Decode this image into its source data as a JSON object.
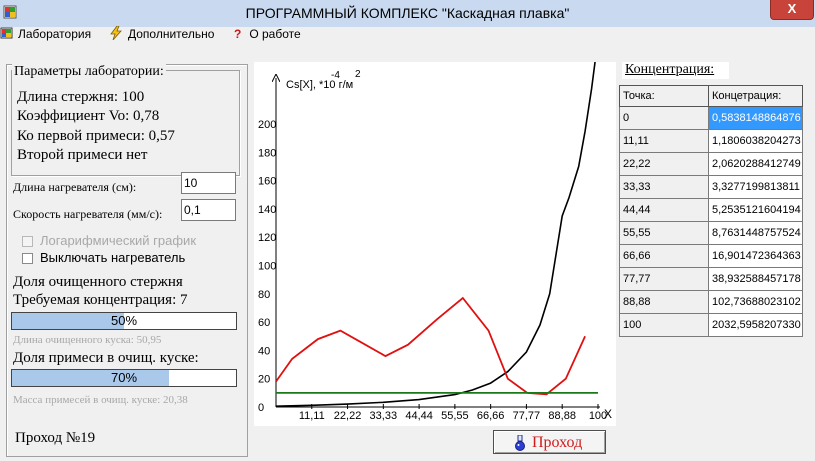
{
  "window": {
    "title": "ПРОГРАММНЫЙ КОМПЛЕКС \"Каскадная плавка\"",
    "close_label": "X"
  },
  "menu": [
    {
      "label": "Лаборатория",
      "icon": "lab-icon"
    },
    {
      "label": "Дополнительно",
      "icon": "lightning-icon"
    },
    {
      "label": "О работе",
      "icon": "question-icon"
    }
  ],
  "params": {
    "caption": "Параметры лаборатории:",
    "rod_length": "Длина стержня: 100",
    "coef": "Коэффициент Vo: 0,78",
    "first_impurity": "Ко первой примеси: 0,57",
    "second_impurity": "Второй примеси нет"
  },
  "heater_length": {
    "label": "Длина нагревателя (см):",
    "value": "10"
  },
  "heater_speed": {
    "label": "Скорость нагревателя (мм/с):",
    "value": "0,1"
  },
  "options": {
    "log_graph": {
      "label": "Логарифмический график",
      "checked": false,
      "disabled": true
    },
    "heater_off": {
      "label": "Выключать нагреватель",
      "checked": false,
      "disabled": false
    }
  },
  "purified": {
    "title": "Доля очищенного стержня",
    "required": "Требуемая концентрация: 7",
    "percent": 50,
    "percent_label": "50%",
    "length_note": "Длина очищенного куска: 50,95"
  },
  "impurity": {
    "title": "Доля примеси в очищ. куске:",
    "percent": 70,
    "percent_label": "70%",
    "mass_note": "Масса примесей в очищ. куске: 20,38"
  },
  "pass_label": "Проход №19",
  "go_button": "Проход",
  "table": {
    "caption": "Концентрация:",
    "headers": [
      "Точка:",
      "Концетрация:"
    ],
    "rows": [
      [
        "0",
        "0,5838148864876"
      ],
      [
        "11,11",
        "1,1806038204273"
      ],
      [
        "22,22",
        "2,0620288412749"
      ],
      [
        "33,33",
        "3,3277199813811"
      ],
      [
        "44,44",
        "5,2535121604194"
      ],
      [
        "55,55",
        "8,7631448757524"
      ],
      [
        "66,66",
        "16,901472364363"
      ],
      [
        "77,77",
        "38,932588457178"
      ],
      [
        "88,88",
        "102,73688023102"
      ],
      [
        "100",
        "2032,5958207330"
      ]
    ]
  },
  "chart_data": {
    "type": "line",
    "ylabel": "Cs[X], *10 г/м",
    "ylabel_exp1": "-4",
    "ylabel_exp2": "2",
    "xlabel": "X",
    "xlim": [
      0,
      100
    ],
    "ylim": [
      0,
      210
    ],
    "xticks": [
      "11,11",
      "22,22",
      "33,33",
      "44,44",
      "55,55",
      "66,66",
      "77,77",
      "88,88",
      "100"
    ],
    "xtick_values": [
      11.11,
      22.22,
      33.33,
      44.44,
      55.55,
      66.66,
      77.77,
      88.88,
      100
    ],
    "yticks": [
      0,
      20,
      40,
      60,
      80,
      100,
      120,
      140,
      160,
      180,
      200
    ],
    "colors": {
      "concentration": "#000000",
      "distribution": "#e01010",
      "required": "#1a7a1a"
    },
    "series": [
      {
        "color": "#000000",
        "x": [
          0,
          11.11,
          22.22,
          33.33,
          44.44,
          50,
          55.55,
          61,
          66.66,
          72,
          77.77,
          82,
          85,
          88.88,
          91,
          94,
          96,
          98,
          100
        ],
        "y": [
          0.58,
          1.18,
          2.06,
          3.33,
          5.25,
          7,
          8.76,
          12,
          16.9,
          25,
          38.9,
          58,
          80,
          135,
          148,
          170,
          195,
          225,
          260
        ]
      },
      {
        "color": "#e01010",
        "x": [
          0,
          5,
          13,
          20,
          27,
          34,
          41,
          50,
          58,
          66,
          72,
          78,
          84,
          90,
          96
        ],
        "y": [
          18,
          34,
          48,
          54,
          45,
          36,
          44,
          62,
          77,
          54,
          20,
          10,
          9,
          20,
          50
        ]
      },
      {
        "color": "#1a7a1a",
        "x": [
          0,
          100
        ],
        "y": [
          10,
          10
        ]
      }
    ]
  }
}
